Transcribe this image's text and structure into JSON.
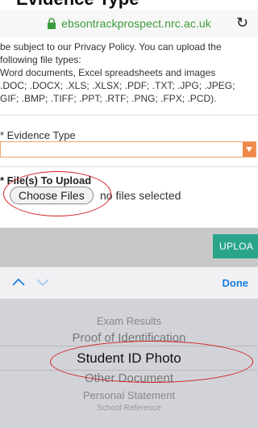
{
  "page": {
    "heading_fragment": "Evidence Type"
  },
  "browser": {
    "url": "ebsontrackprospect.nrc.ac.uk"
  },
  "policy": {
    "lines": [
      "be subject to our Privacy Policy. You can upload the",
      "following file types:",
      "Word documents, Excel spreadsheets and images",
      ".DOC; .DOCX; .XLS; .XLSX; .PDF; .TXT; .JPG; .JPEG;",
      "GIF; .BMP; .TIFF; .PPT; .RTF; .PNG; .FPX; .PCD)."
    ]
  },
  "form": {
    "evidence_label": "* Evidence Type",
    "evidence_value": "",
    "files_label": "* File(s) To Upload",
    "choose_files": "Choose Files",
    "no_files": "no files selected",
    "upload_button": "UPLOA"
  },
  "picker_toolbar": {
    "done": "Done"
  },
  "picker": {
    "options": [
      "Exam Results",
      "Proof of Identification",
      "Student ID Photo",
      "Other Document",
      "Personal Statement",
      "School Reference"
    ],
    "selected": "Student ID Photo"
  },
  "colors": {
    "accent_upload": "#2aa58c",
    "select_arrow": "#f0884a",
    "done_blue": "#1a7ee0",
    "annotation_red": "#d42020",
    "url_green": "#3a9b3a"
  }
}
